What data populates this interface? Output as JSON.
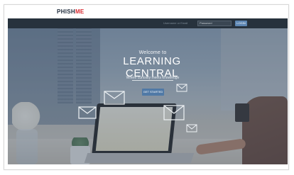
{
  "brand": {
    "logo_prefix": "PHISH",
    "logo_suffix": "ME"
  },
  "navbar": {
    "search_hint": "Username or Email",
    "password_placeholder": "Password",
    "login_label": "LOGIN"
  },
  "hero": {
    "welcome": "Welcome to",
    "title": "LEARNING CENTRAL",
    "subtitle": "Where curiosity meets knowledge",
    "cta_label": "GET STARTED"
  },
  "colors": {
    "navbar_bg": "#27323d",
    "accent": "#5079a6",
    "logo_red": "#d9282f"
  }
}
